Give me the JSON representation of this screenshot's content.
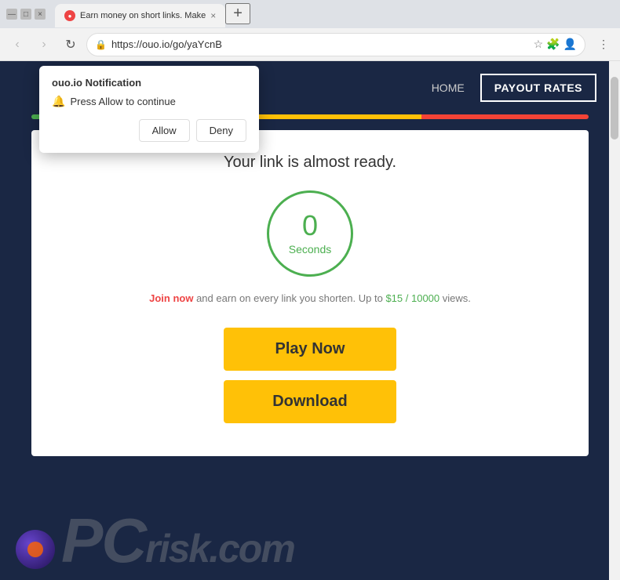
{
  "browser": {
    "title": "Earn money on short links. Make",
    "url": "https://ouo.io/go/yaYcnB",
    "tab_close": "×",
    "new_tab": "+"
  },
  "nav": {
    "back": "‹",
    "forward": "›",
    "refresh": "↻",
    "home": "⌂"
  },
  "notification": {
    "title": "ouo.io Notification",
    "message": "Press Allow to continue",
    "allow_label": "Allow",
    "deny_label": "Deny"
  },
  "site": {
    "nav_home": "HOME",
    "nav_payout": "PAYOUT RATES"
  },
  "main": {
    "card_title": "Your link is almost ready.",
    "timer_number": "0",
    "timer_label": "Seconds",
    "promo_join": "Join now",
    "promo_middle": " and earn on every link you shorten. Up to ",
    "promo_amount": "$15 / 10000",
    "promo_end": " views.",
    "play_now": "Play Now",
    "download": "Download"
  },
  "watermark": {
    "text": "risk.com"
  }
}
